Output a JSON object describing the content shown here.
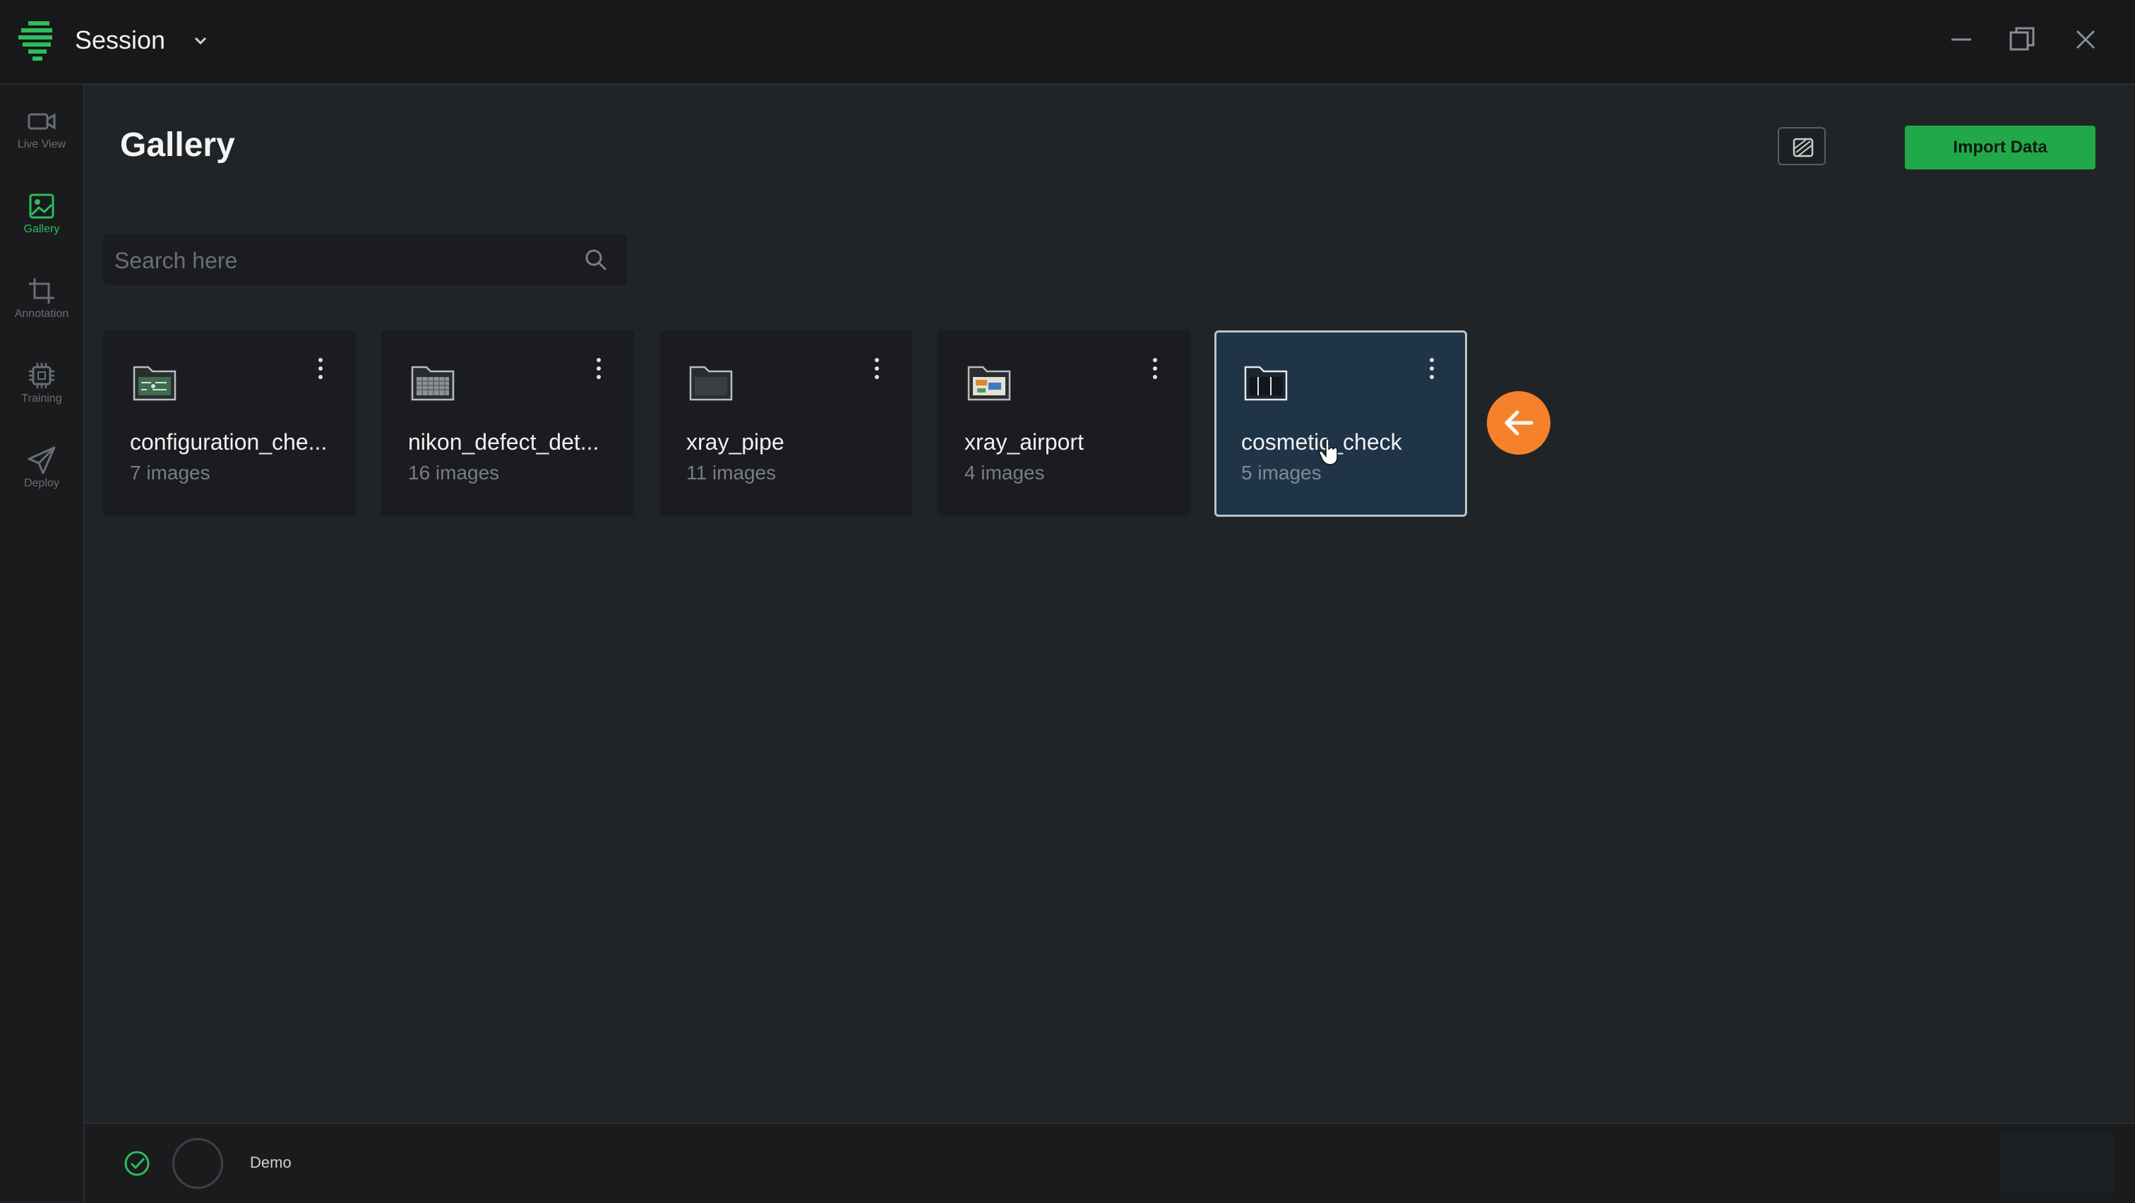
{
  "app": {
    "session_label": "Session"
  },
  "sidebar": {
    "items": [
      {
        "label": "Live View",
        "icon": "video-camera-icon",
        "active": false
      },
      {
        "label": "Gallery",
        "icon": "image-icon",
        "active": true
      },
      {
        "label": "Annotation",
        "icon": "crop-icon",
        "active": false
      },
      {
        "label": "Training",
        "icon": "chip-icon",
        "active": false
      },
      {
        "label": "Deploy",
        "icon": "send-icon",
        "active": false
      }
    ]
  },
  "header": {
    "title": "Gallery",
    "import_label": "Import Data"
  },
  "search": {
    "placeholder": "Search here",
    "value": ""
  },
  "datasets": [
    {
      "name": "configuration_che...",
      "count": "7 images",
      "thumb": "circuit-folder-icon"
    },
    {
      "name": "nikon_defect_det...",
      "count": "16 images",
      "thumb": "grid-folder-icon"
    },
    {
      "name": "xray_pipe",
      "count": "11 images",
      "thumb": "folder-icon"
    },
    {
      "name": "xray_airport",
      "count": "4 images",
      "thumb": "xray-folder-icon"
    },
    {
      "name": "cosmetic_check",
      "count": "5 images",
      "thumb": "folder-icon",
      "selected": true
    }
  ],
  "statusbar": {
    "user": "Demo"
  },
  "colors": {
    "accent": "#21a84a",
    "active_nav": "#2dbd5a",
    "selected_card": "#1f3446",
    "fab": "#f5822a"
  }
}
